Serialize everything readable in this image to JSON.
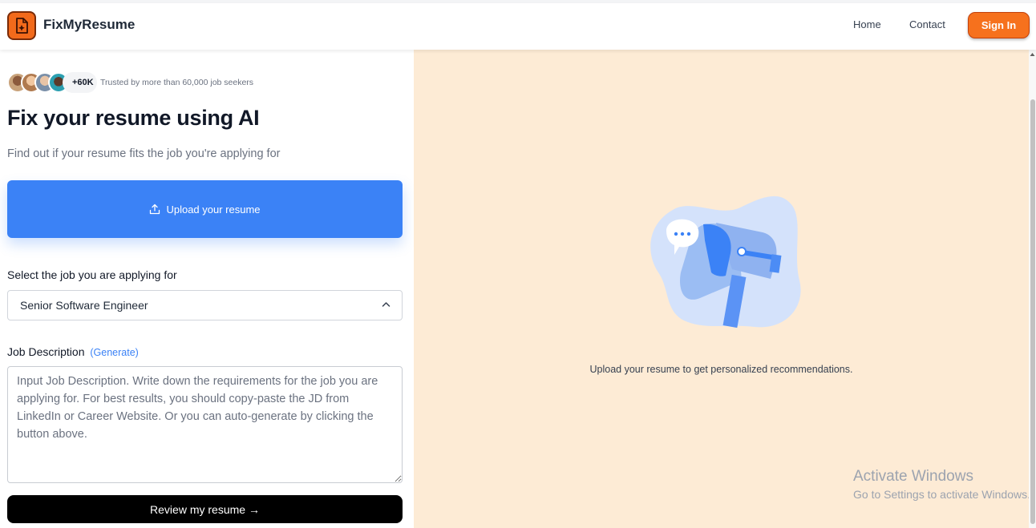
{
  "header": {
    "brand": "FixMyResume",
    "nav": {
      "home": "Home",
      "contact": "Contact"
    },
    "signin_label": "Sign In",
    "accent": "#f6711d"
  },
  "hero": {
    "avatar_count": "+60K",
    "trusted_text": "Trusted by more than 60,000 job seekers",
    "title": "Fix your resume using AI",
    "subtitle": "Find out if your resume fits the job you're applying for",
    "upload_label": "Upload your resume",
    "upload_icon": "upload-icon",
    "upload_color": "#3b82f6"
  },
  "form": {
    "select_label": "Select the job you are applying for",
    "selected_job": "Senior Software Engineer",
    "jd_label": "Job Description",
    "jd_generate": "(Generate)",
    "jd_placeholder": "Input Job Description. Write down the requirements for the job you are applying for. For best results, you should copy-paste the JD from LinkedIn or Career Website. Or you can auto-generate by clicking the button above.",
    "review_label": "Review my resume →"
  },
  "panel": {
    "recommendation_text": "Upload your resume to get personalized recommendations.",
    "background": "#fdebd5"
  },
  "watermark": {
    "title": "Activate Windows",
    "subtitle": "Go to Settings to activate Windows."
  }
}
